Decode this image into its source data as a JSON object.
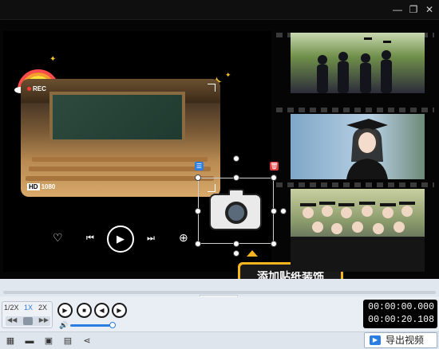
{
  "titlebar": {
    "minimize": "—",
    "restore": "❐",
    "close": "✕"
  },
  "preview": {
    "rec_label": "REC",
    "hd_badge": "HD",
    "hd_value": "1080",
    "sticker_tooltip": "添加贴纸装饰"
  },
  "controls": {
    "speeds": [
      "1/2X",
      "1X",
      "2X"
    ],
    "active_speed": "1X",
    "current_time": "00:00:00.000",
    "total_time": "00:00:20.108",
    "volume_level": 0.8
  },
  "toolbar": {
    "export_label": "导出视频"
  },
  "colors": {
    "accent": "#2a7de1",
    "tooltip": "#f5b51e",
    "delete": "#e23b3b"
  }
}
